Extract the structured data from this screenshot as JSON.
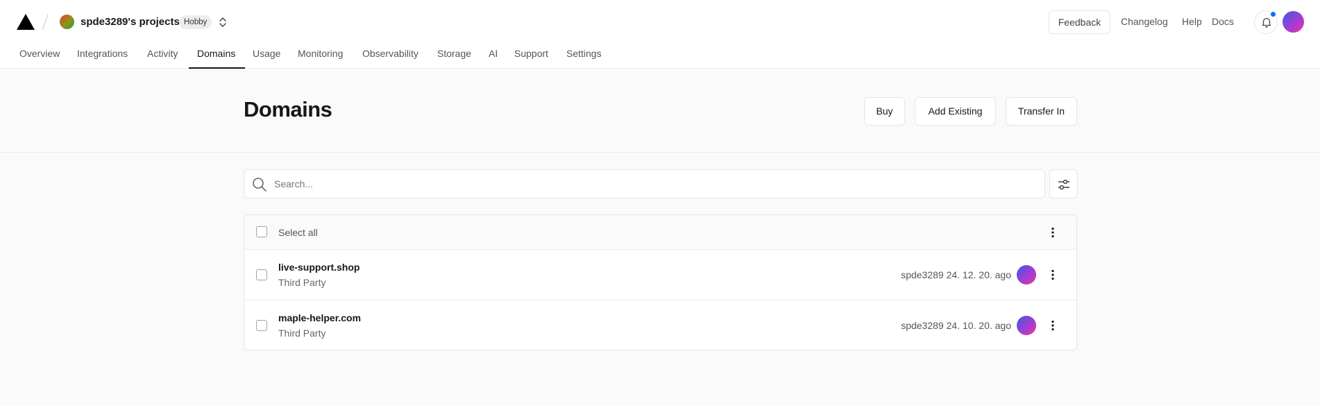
{
  "team": {
    "name": "spde3289's projects",
    "plan": "Hobby"
  },
  "top_links": {
    "feedback": "Feedback",
    "changelog": "Changelog",
    "help": "Help",
    "docs": "Docs"
  },
  "tabs": [
    {
      "label": "Overview"
    },
    {
      "label": "Integrations"
    },
    {
      "label": "Activity"
    },
    {
      "label": "Domains",
      "active": true
    },
    {
      "label": "Usage"
    },
    {
      "label": "Monitoring"
    },
    {
      "label": "Observability"
    },
    {
      "label": "Storage"
    },
    {
      "label": "AI"
    },
    {
      "label": "Support"
    },
    {
      "label": "Settings"
    }
  ],
  "page": {
    "title": "Domains",
    "actions": {
      "buy": "Buy",
      "add_existing": "Add Existing",
      "transfer_in": "Transfer In"
    }
  },
  "search": {
    "placeholder": "Search...",
    "value": ""
  },
  "table": {
    "select_all_label": "Select all",
    "rows": [
      {
        "domain": "live-support.shop",
        "registrar": "Third Party",
        "meta": "spde3289 24. 12. 20. ago"
      },
      {
        "domain": "maple-helper.com",
        "registrar": "Third Party",
        "meta": "spde3289 24. 10. 20. ago"
      }
    ]
  },
  "colors": {
    "accent_active": "#171717",
    "notification_dot": "#0070f3",
    "border": "#e5e5e5",
    "background": "#fafafa"
  },
  "icons": [
    "vercel-logo-icon",
    "slash-separator-icon",
    "chevron-up-down-icon",
    "bell-icon",
    "search-icon",
    "filter-sliders-icon",
    "more-vertical-icon"
  ]
}
